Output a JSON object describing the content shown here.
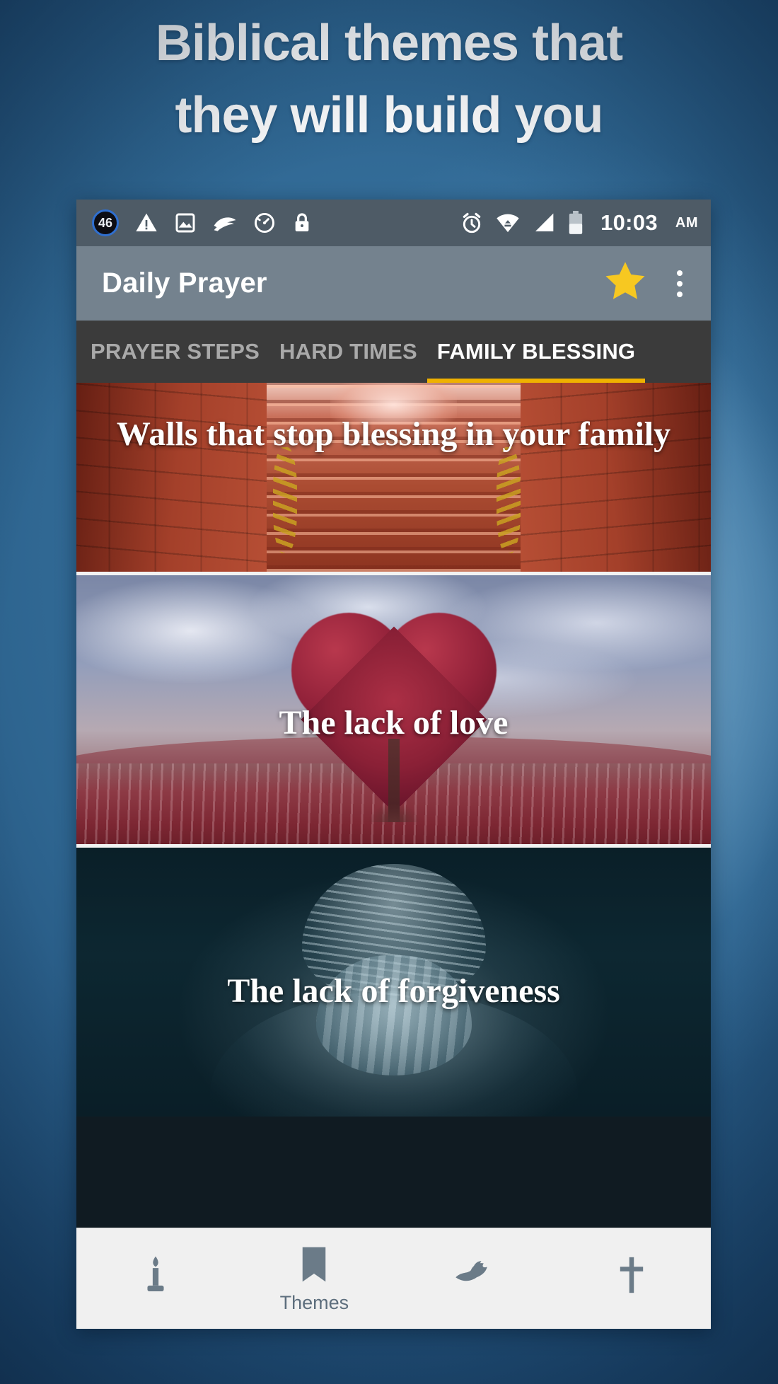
{
  "promo": {
    "headline_lines": [
      "Biblical themes that",
      "they will build you"
    ],
    "background_color": "#2e6590"
  },
  "status_bar": {
    "background_color": "#4e5b66",
    "notification_badge": "46",
    "time": "10:03",
    "am_pm": "AM",
    "left_icons": [
      "notification-count-badge-icon",
      "warning-triangle-icon",
      "image-icon",
      "swipe-swirl-icon",
      "speedometer-icon",
      "lock-icon"
    ],
    "right_icons": [
      "alarm-clock-icon",
      "wifi-icon",
      "cellular-signal-icon",
      "battery-icon"
    ]
  },
  "app_bar": {
    "title": "Daily Prayer",
    "background_color": "#74828e",
    "star_color": "#f7c821",
    "actions": [
      "favorite-star-icon",
      "overflow-menu-icon"
    ]
  },
  "tabs": {
    "background_color": "#3b3b3b",
    "indicator_color": "#efb100",
    "active_index": 2,
    "items": [
      {
        "label": "PRAYER STEPS",
        "active": false
      },
      {
        "label": "HARD TIMES",
        "active": false
      },
      {
        "label": "FAMILY BLESSING",
        "active": true
      }
    ]
  },
  "cards": [
    {
      "title": "Walls that stop blessing in your family",
      "image": "red-stone-stairway"
    },
    {
      "title": "The lack of love",
      "image": "heart-shaped-red-tree"
    },
    {
      "title": "The lack of forgiveness",
      "image": "person-head-in-hands"
    }
  ],
  "bottom_nav": {
    "background_color": "#f0f0f0",
    "items": [
      {
        "icon": "candle-icon",
        "label": "",
        "active": false
      },
      {
        "icon": "book-bookmark-icon",
        "label": "Themes",
        "active": true
      },
      {
        "icon": "dove-icon",
        "label": "",
        "active": false
      },
      {
        "icon": "cross-icon",
        "label": "",
        "active": false
      }
    ]
  }
}
